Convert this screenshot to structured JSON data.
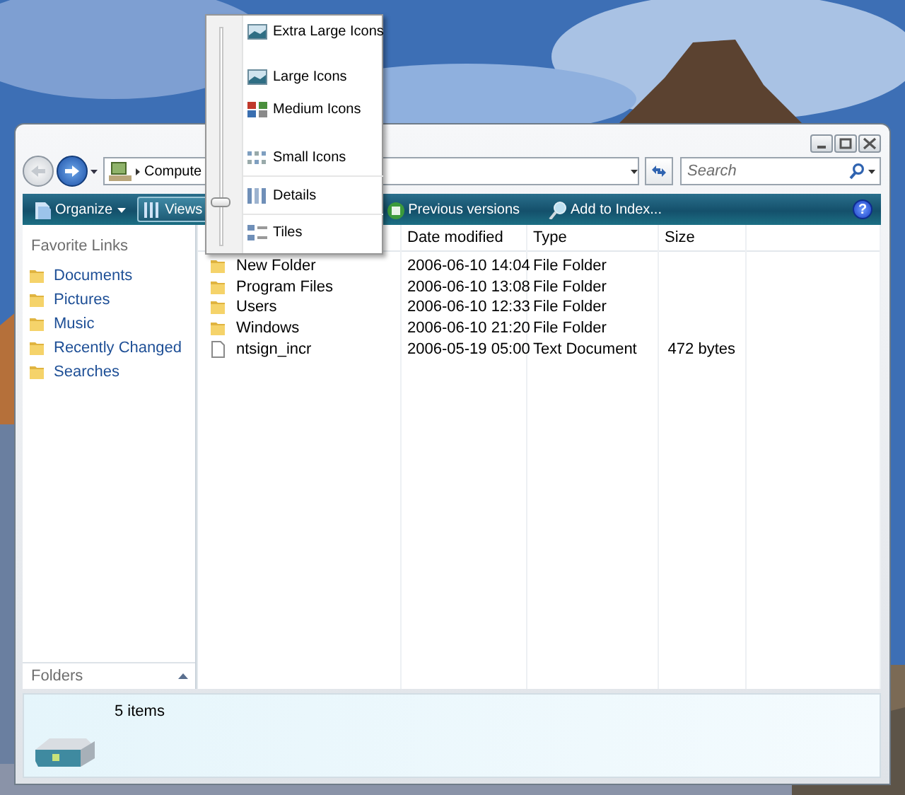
{
  "address_bar": {
    "path": "Compute"
  },
  "search": {
    "placeholder": "Search"
  },
  "toolbar": {
    "buttons": [
      {
        "label": "Organize",
        "kind": "dropdown",
        "pressed": false
      },
      {
        "label": "Views",
        "kind": "plain",
        "pressed": true
      },
      {
        "label": "Previous versions",
        "kind": "plain",
        "pressed": false
      },
      {
        "label": "Add to Index...",
        "kind": "plain",
        "pressed": false
      }
    ],
    "help": "?"
  },
  "views_menu": {
    "items": [
      {
        "label": "Extra Large Icons",
        "kind": "thumb"
      },
      {
        "label": "Large Icons",
        "kind": "thumb"
      },
      {
        "label": "Medium Icons",
        "kind": "grid"
      },
      {
        "label": "Small Icons",
        "kind": "dots"
      },
      {
        "label": "Details",
        "kind": "list"
      },
      {
        "label": "Tiles",
        "kind": "tiles"
      }
    ],
    "slider": {
      "level": 0.2
    }
  },
  "favorite_links": {
    "title": "Favorite Links",
    "items": [
      {
        "label": "Documents"
      },
      {
        "label": "Pictures"
      },
      {
        "label": "Music"
      },
      {
        "label": "Recently Changed"
      },
      {
        "label": "Searches"
      }
    ]
  },
  "folders": {
    "label": "Folders",
    "expanded": false
  },
  "file_list": {
    "columns": [
      "Date modified",
      "Type",
      "Size"
    ],
    "rows": [
      {
        "name": "New Folder",
        "date": "2006-06-10 14:04",
        "type": "File Folder",
        "kind": "folder"
      },
      {
        "name": "Program Files",
        "date": "2006-06-10 13:08",
        "type": "File Folder",
        "kind": "folder"
      },
      {
        "name": "Users",
        "date": "2006-06-10 12:33",
        "type": "File Folder",
        "kind": "folder"
      },
      {
        "name": "Windows",
        "date": "2006-06-10 21:20",
        "type": "File Folder",
        "kind": "folder"
      },
      {
        "name": "ntsign_incr",
        "date": "2006-05-19 05:00",
        "type": "Text Document",
        "size": "472 bytes",
        "kind": "text"
      }
    ]
  },
  "details_pane": {
    "count": "5 items"
  }
}
